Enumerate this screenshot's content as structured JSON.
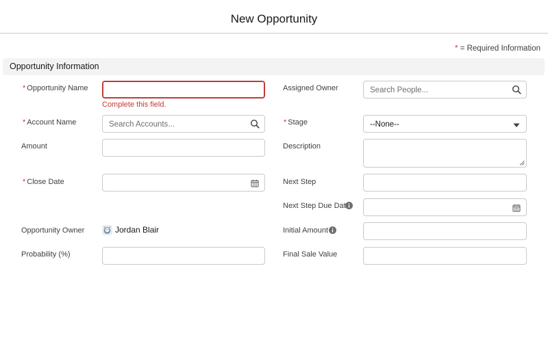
{
  "header": {
    "title": "New Opportunity"
  },
  "legend": {
    "star": "*",
    "text": "= Required Information"
  },
  "section": {
    "title": "Opportunity Information"
  },
  "fields": {
    "opportunity_name": {
      "label": "Opportunity Name",
      "required": true,
      "value": "",
      "error": "Complete this field."
    },
    "account_name": {
      "label": "Account Name",
      "required": true,
      "placeholder": "Search Accounts..."
    },
    "amount": {
      "label": "Amount",
      "value": ""
    },
    "close_date": {
      "label": "Close Date",
      "required": true,
      "value": ""
    },
    "opportunity_owner": {
      "label": "Opportunity Owner",
      "value": "Jordan Blair"
    },
    "probability": {
      "label": "Probability (%)",
      "value": ""
    },
    "assigned_owner": {
      "label": "Assigned Owner",
      "placeholder": "Search People..."
    },
    "stage": {
      "label": "Stage",
      "required": true,
      "selected": "--None--"
    },
    "description": {
      "label": "Description",
      "value": ""
    },
    "next_step": {
      "label": "Next Step",
      "value": ""
    },
    "next_step_due_date": {
      "label": "Next Step Due Date",
      "value": ""
    },
    "initial_amount": {
      "label": "Initial Amount",
      "value": ""
    },
    "final_sale_value": {
      "label": "Final Sale Value",
      "value": ""
    }
  },
  "required_marker": "*",
  "colors": {
    "required": "#c23934",
    "border": "#c9c9c9",
    "section_bg": "#f3f3f3"
  },
  "icons": [
    "search-icon",
    "calendar-icon",
    "chevron-down-icon",
    "info-icon",
    "avatar"
  ]
}
